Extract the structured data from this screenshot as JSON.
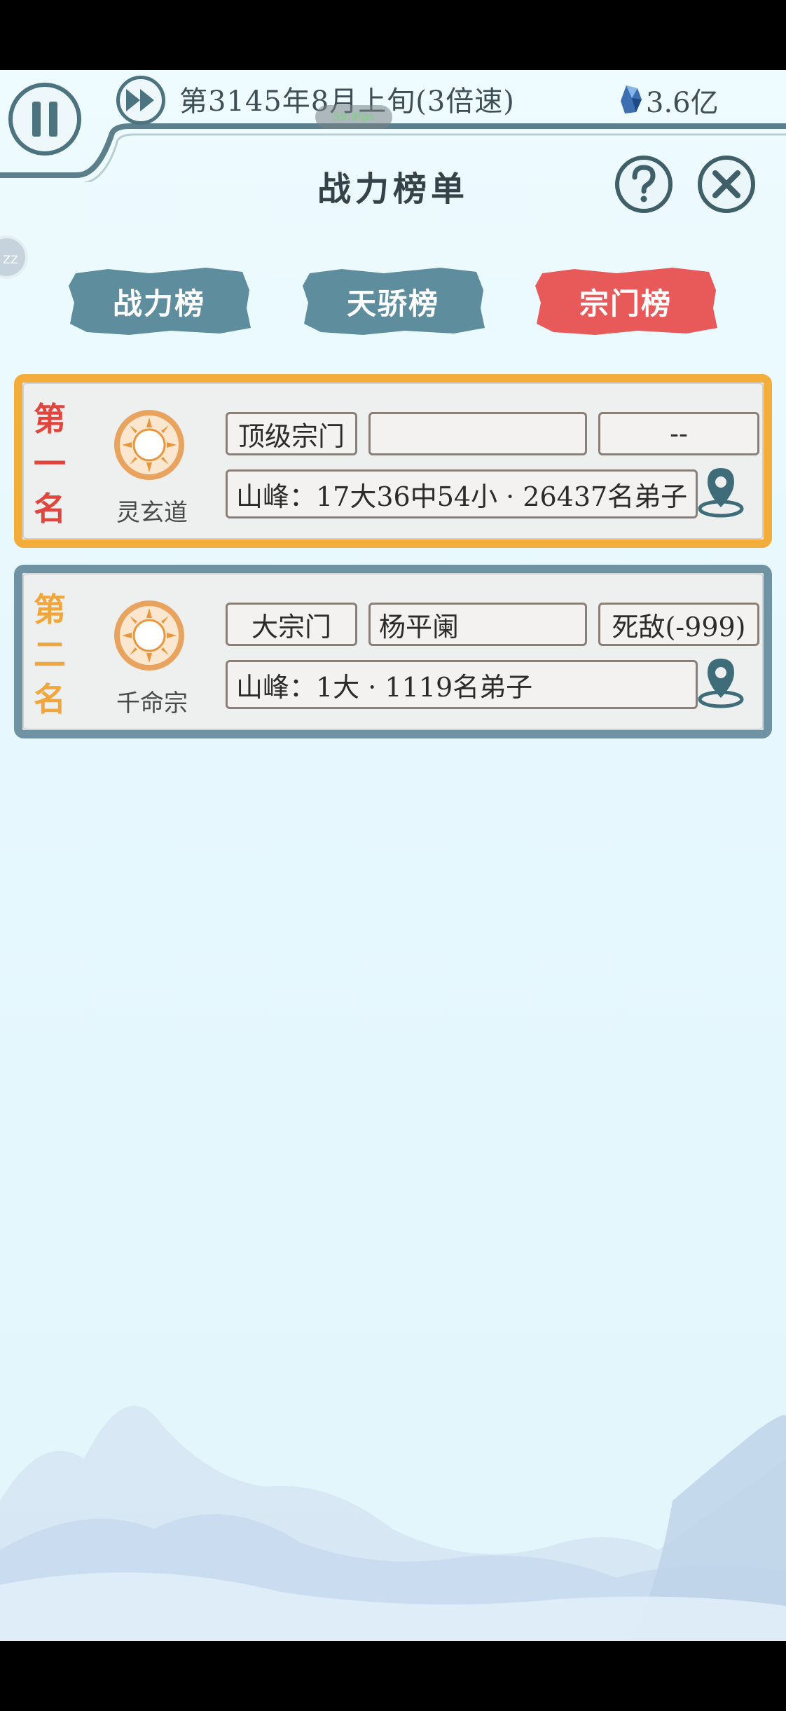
{
  "header": {
    "date_text": "第3145年8月上旬(3倍速)",
    "fps_label": "59.9fps",
    "currency_value": "3.6亿",
    "title": "战力榜单"
  },
  "tabs": [
    {
      "label": "战力榜",
      "active": false,
      "color": "#5e8e9e"
    },
    {
      "label": "天骄榜",
      "active": false,
      "color": "#5e8e9e"
    },
    {
      "label": "宗门榜",
      "active": true,
      "color": "#e85a5a"
    }
  ],
  "rankings": [
    {
      "rank_chars": [
        "第",
        "一",
        "名"
      ],
      "rank_color": "#e0463e",
      "sect_name": "灵玄道",
      "level": "顶级宗门",
      "leader": "",
      "relation": "--",
      "detail": "山峰：17大36中54小 · 26437名弟子"
    },
    {
      "rank_chars": [
        "第",
        "二",
        "名"
      ],
      "rank_color": "#f0a63a",
      "sect_name": "千命宗",
      "level": "大宗门",
      "leader": "杨平阑",
      "relation": "死敌(-999)",
      "detail": "山峰：1大 · 1119名弟子"
    }
  ],
  "side_handle": "ZZ",
  "colors": {
    "accent_dark": "#4c7480",
    "gold_border": "#f3ad3a",
    "blue_border": "#6f93a3"
  }
}
